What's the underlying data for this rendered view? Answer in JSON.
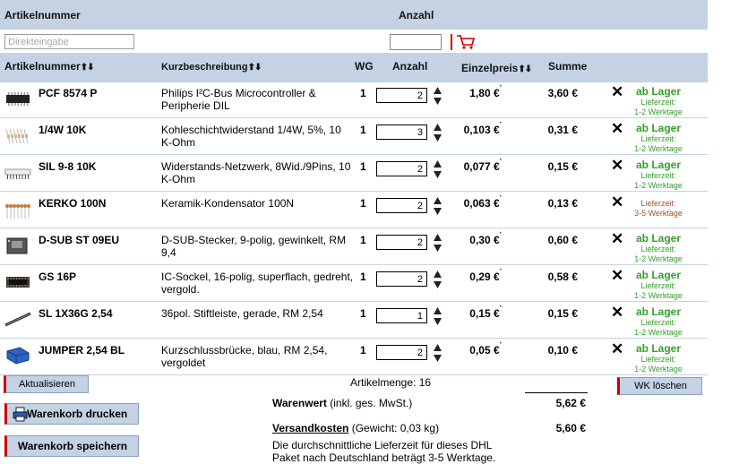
{
  "quick_entry": {
    "col_article": "Artikelnummer",
    "col_qty": "Anzahl",
    "direct_placeholder": "Direkteingabe"
  },
  "columns": {
    "article": "Artikelnummer",
    "short_desc": "Kurzbeschreibung",
    "wg": "WG",
    "qty": "Anzahl",
    "unit_price": "Einzelpreis",
    "sum": "Summe"
  },
  "rows": [
    {
      "art": "PCF 8574 P",
      "desc": "Philips I²C-Bus Microcontroller & Peripherie DIL",
      "wg": "1",
      "qty": "2",
      "price": "1,80 €",
      "sup": "*",
      "sum": "3,60 €",
      "avail_big": "ab Lager",
      "avail_small1": "Lieferzeit:",
      "avail_small2": "1-2 Werktage",
      "icon": "ic-chip-icon"
    },
    {
      "art": "1/4W 10K",
      "desc": "Kohleschichtwiderstand 1/4W, 5%, 10 K-Ohm",
      "wg": "1",
      "qty": "3",
      "price": "0,103 €",
      "sup": "*",
      "sum": "0,31 €",
      "avail_big": "ab Lager",
      "avail_small1": "Lieferzeit:",
      "avail_small2": "1-2 Werktage",
      "icon": "resistor-icon"
    },
    {
      "art": "SIL 9-8 10K",
      "desc": "Widerstands-Netzwerk, 8Wid./9Pins, 10 K-Ohm",
      "wg": "1",
      "qty": "2",
      "price": "0,077 €",
      "sup": "*",
      "sum": "0,15 €",
      "avail_big": "ab Lager",
      "avail_small1": "Lieferzeit:",
      "avail_small2": "1-2 Werktage",
      "icon": "resistor-network-icon"
    },
    {
      "art": "KERKO 100N",
      "desc": "Keramik-Kondensator 100N",
      "wg": "1",
      "qty": "2",
      "price": "0,063 €",
      "sup": "*",
      "sum": "0,13 €",
      "avail_big": "",
      "avail_small1": "Lieferzeit:",
      "avail_small2": "3-5 Werktage",
      "icon": "capacitor-icon"
    },
    {
      "art": "D-SUB ST 09EU",
      "desc": "D-SUB-Stecker, 9-polig, gewinkelt, RM 9,4",
      "wg": "1",
      "qty": "2",
      "price": "0,30 €",
      "sup": "*",
      "sum": "0,60 €",
      "avail_big": "ab Lager",
      "avail_small1": "Lieferzeit:",
      "avail_small2": "1-2 Werktage",
      "icon": "dsub-connector-icon"
    },
    {
      "art": "GS 16P",
      "desc": "IC-Sockel, 16-polig, superflach, gedreht, vergold.",
      "wg": "1",
      "qty": "2",
      "price": "0,29 €",
      "sup": "*",
      "sum": "0,58 €",
      "avail_big": "ab Lager",
      "avail_small1": "Lieferzeit:",
      "avail_small2": "1-2 Werktage",
      "icon": "ic-socket-icon"
    },
    {
      "art": "SL 1X36G 2,54",
      "desc": "36pol. Stiftleiste, gerade, RM 2,54",
      "wg": "1",
      "qty": "1",
      "price": "0,15 €",
      "sup": "*",
      "sum": "0,15 €",
      "avail_big": "ab Lager",
      "avail_small1": "Lieferzeit:",
      "avail_small2": "1-2 Werktage",
      "icon": "pin-header-icon"
    },
    {
      "art": "JUMPER 2,54 BL",
      "desc": "Kurzschlussbrücke, blau, RM 2,54, vergoldet",
      "wg": "1",
      "qty": "2",
      "price": "0,05 €",
      "sup": "*",
      "sum": "0,10 €",
      "avail_big": "ab Lager",
      "avail_small1": "Lieferzeit:",
      "avail_small2": "1-2 Werktage",
      "icon": "jumper-icon"
    }
  ],
  "footer": {
    "update_btn": "Aktualisieren",
    "article_count": "Artikelmenge: 16",
    "clear_btn": "WK löschen",
    "print_btn": "Warenkorb drucken",
    "save_btn": "Warenkorb speichern",
    "goods_value_label": "Warenwert",
    "goods_value_note": "(inkl. ges. MwSt.)",
    "goods_value": "5,62 €",
    "shipping_label": "Versandkosten",
    "shipping_note": "(Gewicht: 0,03 kg)",
    "shipping_value": "5,60 €",
    "delivery_note": "Die durchschnittliche Lieferzeit für dieses DHL Paket nach Deutschland beträgt 3-5 Werktage."
  },
  "colors": {
    "header_bg": "#c4d2e4",
    "in_stock": "#33a02c",
    "lead_time": "#a0522d",
    "accent_red": "#cc0000"
  }
}
